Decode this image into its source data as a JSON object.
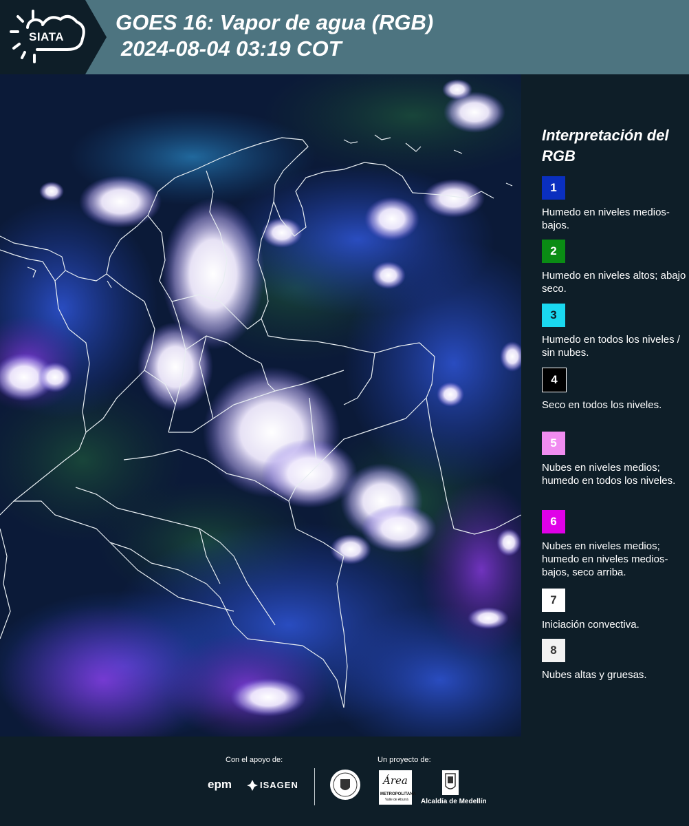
{
  "header": {
    "logo_text": "SIATA",
    "title_line1": "GOES 16: Vapor de agua (RGB)",
    "title_line2": "2024-08-04 03:19 COT",
    "bar_color": "#4d7480",
    "dark_color": "#0e1e28"
  },
  "legend": {
    "title": "Interpretación del RGB",
    "items": [
      {
        "number": "1",
        "label": "Humedo en niveles medios-bajos.",
        "color": "#0a2fbf",
        "text_color": "#ffffff"
      },
      {
        "number": "2",
        "label": "Humedo en niveles altos; abajo seco.",
        "color": "#0a8c14",
        "text_color": "#ffffff"
      },
      {
        "number": "3",
        "label": "Humedo en todos los niveles / sin nubes.",
        "color": "#1ad8f0",
        "text_color": "#0e1e28"
      },
      {
        "number": "4",
        "label": "Seco en todos los niveles.",
        "color": "#000000",
        "text_color": "#ffffff"
      },
      {
        "number": "5",
        "label": "Nubes en niveles medios; humedo en todos los niveles.",
        "color": "#f08cf0",
        "text_color": "#ffffff"
      },
      {
        "number": "6",
        "label": "Nubes en niveles medios; humedo en niveles medios-bajos, seco arriba.",
        "color": "#e000e8",
        "text_color": "#ffffff"
      },
      {
        "number": "7",
        "label": "Iniciación convectiva.",
        "color": "#ffffff",
        "text_color": "#333333"
      },
      {
        "number": "8",
        "label": "Nubes altas y gruesas.",
        "color": "#f2f2f2",
        "text_color": "#333333"
      }
    ]
  },
  "footer": {
    "support_label": "Con el apoyo de:",
    "project_label": "Un proyecto de:",
    "sponsor_epm": "epm",
    "sponsor_isagen": "ISAGEN",
    "amva_script": "Área",
    "amva_line1": "METROPOLITANA",
    "amva_line2": "Valle de Aburrá",
    "alcaldia": "Alcaldía de Medellín"
  }
}
